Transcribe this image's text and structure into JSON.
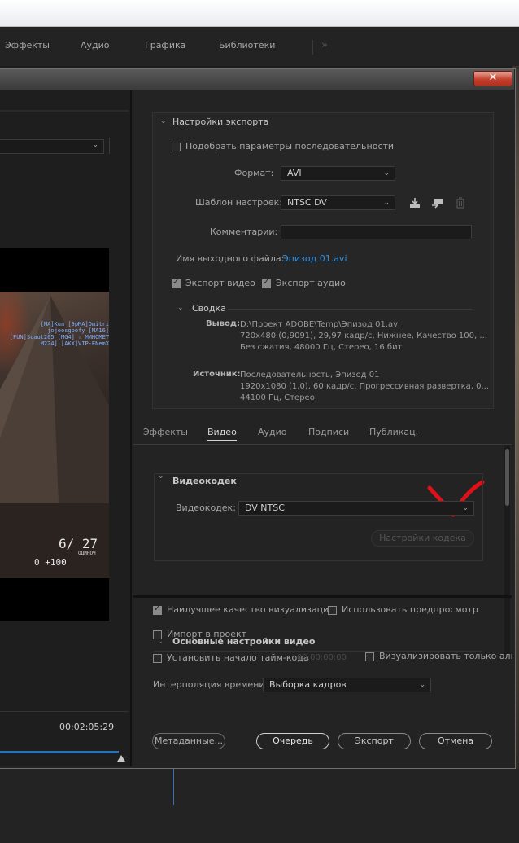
{
  "menubar": {
    "items": [
      "Эффекты",
      "Аудио",
      "Графика",
      "Библиотеки"
    ],
    "overflow": "»"
  },
  "dialog": {
    "close_glyph": "✕"
  },
  "source": {
    "timecode": "00:02:05:29"
  },
  "hud": {
    "names": "[MA]Kun  [ЭрMA]Dmitri  jojoosgoofy [MA16] [FUN]Scaut205 [MG4] ☆ МИНОМЕТ M224] [АКХ]VIP-ENemX",
    "ammo_top": "6/ 27",
    "ammo_sub": "ОДИНОЧ",
    "score": "0  +100"
  },
  "export": {
    "section_title": "Настройки экспорта",
    "match_sequence_label": "Подобрать параметры последовательности",
    "format_label": "Формат:",
    "format_value": "AVI",
    "preset_label": "Шаблон настроек:",
    "preset_value": "NTSC DV",
    "comments_label": "Комментарии:",
    "comments_value": "",
    "output_name_label": "Имя выходного файла:",
    "output_name_value": "Эпизод 01.avi",
    "export_video_label": "Экспорт видео",
    "export_audio_label": "Экспорт аудио",
    "export_video_checked": true,
    "export_audio_checked": true
  },
  "summary": {
    "title": "Сводка",
    "output_label": "Вывод:",
    "output_lines": [
      "D:\\Проект ADOBE\\Temp\\Эпизод 01.avi",
      "720x480 (0,9091), 29,97 кадр/с, Нижнее, Качество 100, ...",
      "Без сжатия, 48000 Гц, Стерео, 16 бит"
    ],
    "source_label": "Источник:",
    "source_lines": [
      "Последовательность, Эпизод 01",
      "1920x1080 (1,0), 60 кадр/с, Прогрессивная развертка, 0...",
      "44100 Гц, Стерео"
    ]
  },
  "tabs": {
    "items": [
      "Эффекты",
      "Видео",
      "Аудио",
      "Подписи",
      "Публикац."
    ],
    "active": "Видео"
  },
  "video": {
    "codec_section": "Видеокодек",
    "codec_label": "Видеокодек:",
    "codec_value": "DV NTSC",
    "codec_settings_button": "Настройки кодека",
    "basic_section": "Основные настройки видео"
  },
  "options": {
    "max_quality_label": "Наилучшее качество визуализации",
    "max_quality_checked": true,
    "use_previews_label": "Использовать предпросмотр",
    "use_previews_checked": false,
    "import_label": "Импорт в проект",
    "import_checked": false,
    "set_timecode_label": "Установить начало тайм-кода",
    "set_timecode_checked": false,
    "timecode_placeholder": "00:00:00:00",
    "alpha_label": "Визуализировать только альфа",
    "alpha_checked": false,
    "interp_label": "Интерполяция времени:",
    "interp_value": "Выборка кадров"
  },
  "buttons": {
    "metadata": "Метаданные...",
    "queue": "Очередь",
    "export": "Экспорт",
    "cancel": "Отмена"
  },
  "colors": {
    "accent_link": "#2f8fdd",
    "annotation_red": "#e0101a",
    "close_red": "#c4412d"
  }
}
